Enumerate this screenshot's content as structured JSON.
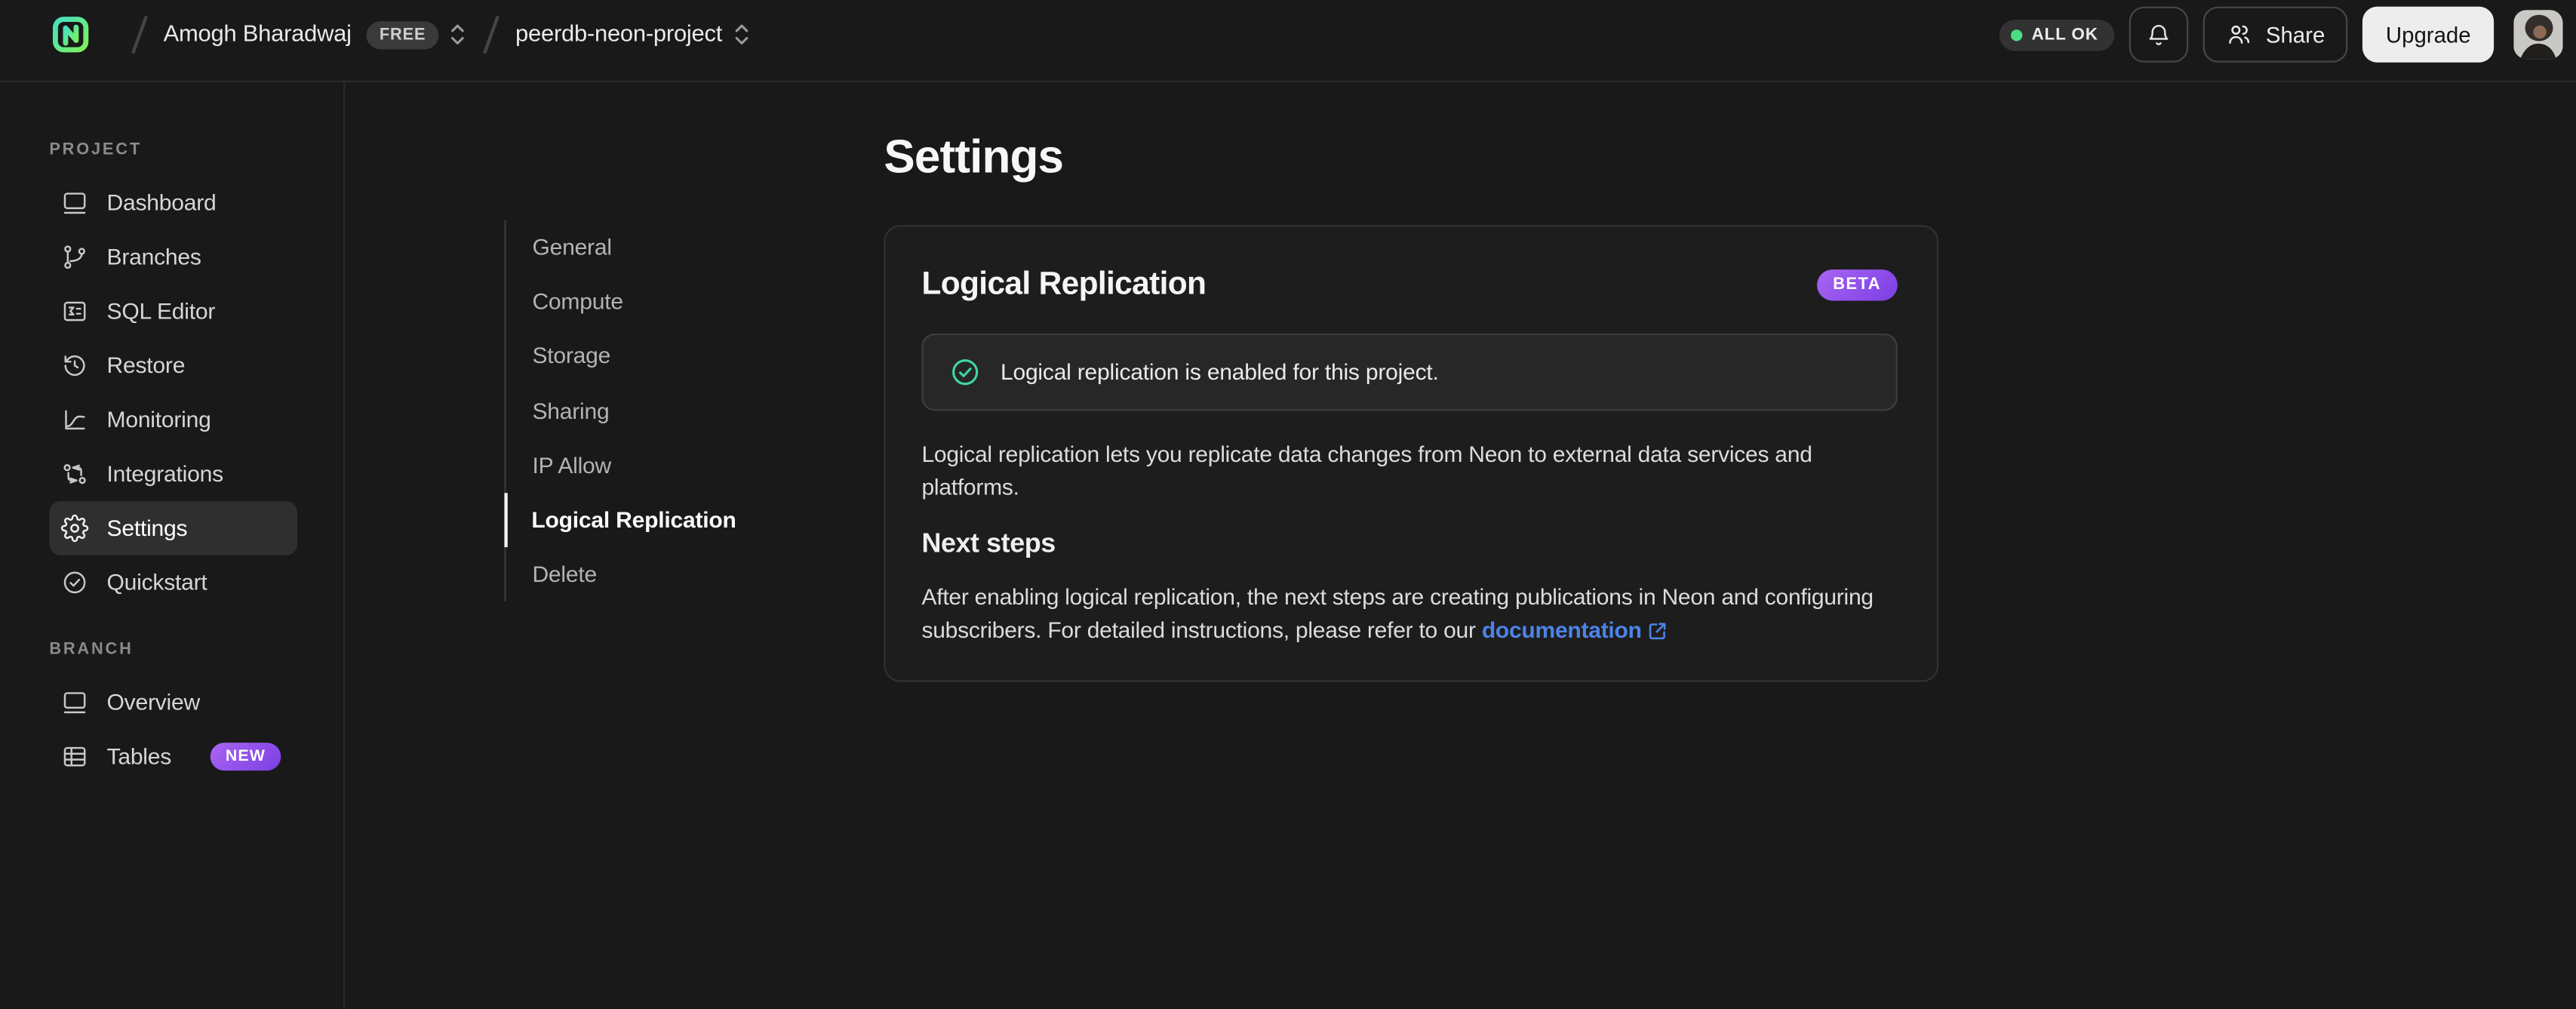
{
  "topbar": {
    "org_name": "Amogh Bharadwaj",
    "org_badge": "FREE",
    "project_name": "peerdb-neon-project",
    "status_label": "ALL OK",
    "share_label": "Share",
    "upgrade_label": "Upgrade"
  },
  "sidebar": {
    "project_section": "PROJECT",
    "branch_section": "BRANCH",
    "project_items": [
      {
        "label": "Dashboard",
        "icon": "dashboard-icon",
        "active": false
      },
      {
        "label": "Branches",
        "icon": "git-branch-icon",
        "active": false
      },
      {
        "label": "SQL Editor",
        "icon": "sql-editor-icon",
        "active": false
      },
      {
        "label": "Restore",
        "icon": "restore-history-icon",
        "active": false
      },
      {
        "label": "Monitoring",
        "icon": "monitoring-chart-icon",
        "active": false
      },
      {
        "label": "Integrations",
        "icon": "integrations-icon",
        "active": false
      },
      {
        "label": "Settings",
        "icon": "gear-icon",
        "active": true
      },
      {
        "label": "Quickstart",
        "icon": "check-circle-icon",
        "active": false
      }
    ],
    "branch_items": [
      {
        "label": "Overview",
        "icon": "overview-window-icon"
      },
      {
        "label": "Tables",
        "icon": "table-grid-icon",
        "badge": "NEW"
      }
    ]
  },
  "settings_nav": {
    "items": [
      {
        "label": "General",
        "active": false
      },
      {
        "label": "Compute",
        "active": false
      },
      {
        "label": "Storage",
        "active": false
      },
      {
        "label": "Sharing",
        "active": false
      },
      {
        "label": "IP Allow",
        "active": false
      },
      {
        "label": "Logical Replication",
        "active": true
      },
      {
        "label": "Delete",
        "active": false
      }
    ]
  },
  "main": {
    "page_title": "Settings",
    "card": {
      "title": "Logical Replication",
      "badge": "BETA",
      "banner_text": "Logical replication is enabled for this project.",
      "description": "Logical replication lets you replicate data changes from Neon to external data services and platforms.",
      "next_steps_title": "Next steps",
      "next_steps_text": "After enabling logical replication, the next steps are creating publications in Neon and configuring subscribers. For detailed instructions, please refer to our ",
      "doc_link_label": "documentation"
    }
  },
  "colors": {
    "background": "#191919",
    "border": "#2a2a2a",
    "card_background": "#1d1d1d",
    "banner_background": "#272727",
    "status_green": "#4ade80",
    "success_check_green": "#3fd9a0",
    "badge_purple_start": "#a965f2",
    "badge_purple_end": "#7b3fe4",
    "link_blue": "#4c83e8",
    "logo_teal": "#45e0c0",
    "logo_green": "#7df25a"
  }
}
